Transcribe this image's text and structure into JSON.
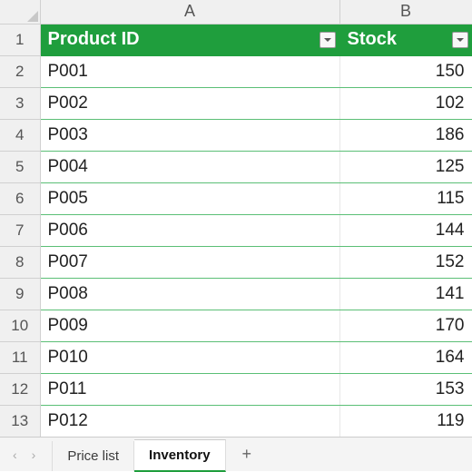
{
  "columns": {
    "A": "A",
    "B": "B"
  },
  "table": {
    "headers": {
      "product_id": "Product ID",
      "stock": "Stock"
    },
    "rows": [
      {
        "row_num": "2",
        "product_id": "P001",
        "stock": "150"
      },
      {
        "row_num": "3",
        "product_id": "P002",
        "stock": "102"
      },
      {
        "row_num": "4",
        "product_id": "P003",
        "stock": "186"
      },
      {
        "row_num": "5",
        "product_id": "P004",
        "stock": "125"
      },
      {
        "row_num": "6",
        "product_id": "P005",
        "stock": "115"
      },
      {
        "row_num": "7",
        "product_id": "P006",
        "stock": "144"
      },
      {
        "row_num": "8",
        "product_id": "P007",
        "stock": "152"
      },
      {
        "row_num": "9",
        "product_id": "P008",
        "stock": "141"
      },
      {
        "row_num": "10",
        "product_id": "P009",
        "stock": "170"
      },
      {
        "row_num": "11",
        "product_id": "P010",
        "stock": "164"
      },
      {
        "row_num": "12",
        "product_id": "P011",
        "stock": "153"
      },
      {
        "row_num": "13",
        "product_id": "P012",
        "stock": "119"
      }
    ]
  },
  "header_row_num": "1",
  "sheets": {
    "nav_prev": "‹",
    "nav_next": "›",
    "tabs": [
      {
        "label": "Price list",
        "active": false
      },
      {
        "label": "Inventory",
        "active": true
      }
    ],
    "add": "+"
  },
  "colors": {
    "table_accent": "#1f9e3d"
  }
}
